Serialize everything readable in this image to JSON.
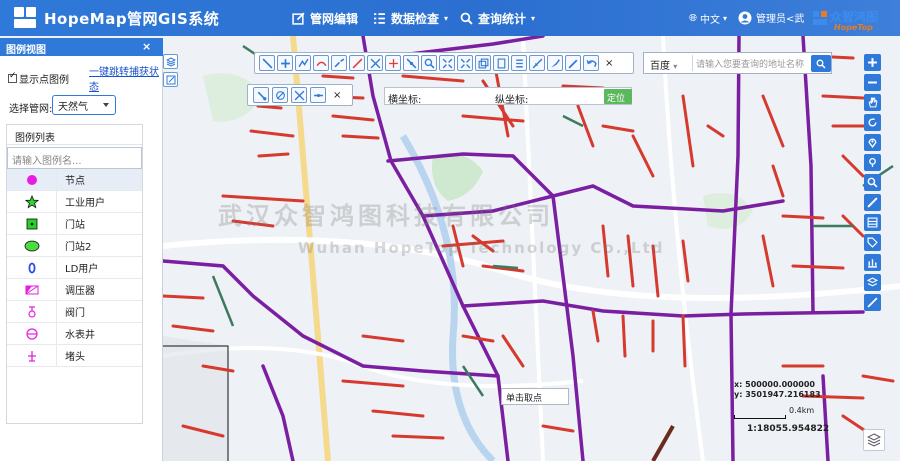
{
  "header": {
    "app_title": "HopeMap管网GIS系统",
    "nav": [
      "管网编辑",
      "数据检查",
      "查询统计"
    ],
    "language": "中文",
    "user": "管理员<武",
    "brand_cn": "众智鸿图",
    "brand_en": "HopeTop"
  },
  "panel": {
    "title": "图例视图",
    "close": "×",
    "collapse": "◀",
    "show_points_label": "显示点图例",
    "capture_link": "一键跳转捕获状态",
    "select_label": "选择管网:",
    "select_value": "天然气",
    "legend_list_title": "图例列表",
    "legend_search_placeholder": "请输入图例名...",
    "legend_items": [
      {
        "label": "节点",
        "icon": "magenta-dot-icon"
      },
      {
        "label": "工业用户",
        "icon": "green-star-icon"
      },
      {
        "label": "门站",
        "icon": "green-square-icon"
      },
      {
        "label": "门站2",
        "icon": "green-ellipse-icon"
      },
      {
        "label": "LD用户",
        "icon": "blue-zero-icon"
      },
      {
        "label": "调压器",
        "icon": "regulator-icon"
      },
      {
        "label": "阀门",
        "icon": "valve-icon"
      },
      {
        "label": "水表井",
        "icon": "meter-well-icon"
      },
      {
        "label": "堵头",
        "icon": "plug-icon"
      }
    ]
  },
  "map": {
    "geocode_source": "百度",
    "geocode_placeholder": "请输入您要查询的地址名称",
    "coord_x_label": "横坐标:",
    "coord_y_label": "纵坐标:",
    "locate_button": "定位",
    "toolbar_close": "×",
    "pick_tip": "单击取点",
    "readout_x": "x: 500000.000000",
    "readout_y": "y: 3501947.216183",
    "scale_label": "0.4km",
    "scale_ratio": "1:18055.954822",
    "watermark_line1": "武汉众智鸿图科技有限公司",
    "watermark_line2": "Wuhan HopeTop Technology Co.,Ltd"
  },
  "colors": {
    "header_bg": "#2f79d8",
    "pipe_main": "#7a1fa2",
    "pipe_branch": "#d63a2f",
    "pipe_low": "#3d7a5f",
    "locate_button": "#5cb85c"
  }
}
